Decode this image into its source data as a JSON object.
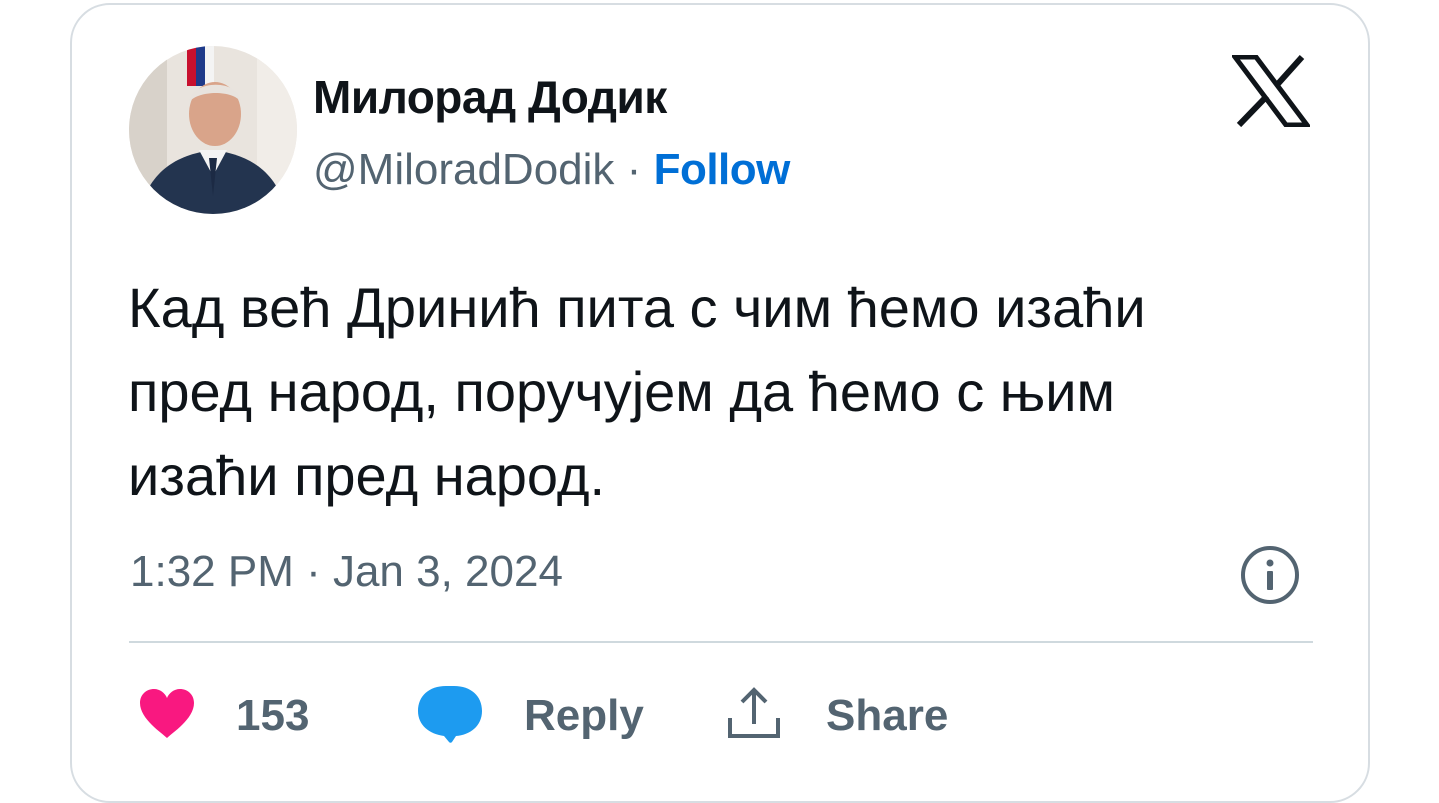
{
  "author": {
    "display_name": "Милорад Додик",
    "handle": "@MiloradDodik",
    "separator": "·",
    "follow_label": "Follow"
  },
  "tweet": {
    "text": "Кад већ Дринић пита с чим ћемо изаћи пред народ, поручујем да ћемо с њим изаћи пред народ.",
    "timestamp": "1:32 PM · Jan 3, 2024"
  },
  "actions": {
    "like_count": "153",
    "reply_label": "Reply",
    "share_label": "Share"
  },
  "icons": {
    "brand": "x-logo-icon",
    "info": "info-icon",
    "like": "heart-icon",
    "reply": "speech-bubble-icon",
    "share": "share-upload-icon"
  },
  "colors": {
    "text_primary": "#0f1419",
    "text_secondary": "#536471",
    "follow_blue": "#006fd6",
    "like_pink": "#f91880",
    "reply_blue": "#1d9bf0",
    "border": "#cfd9de"
  }
}
